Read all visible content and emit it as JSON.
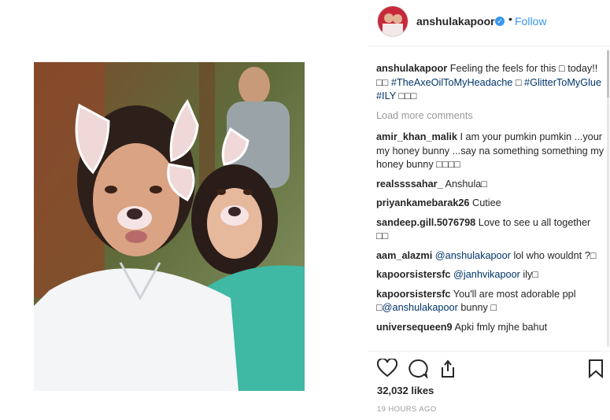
{
  "post": {
    "username": "anshulakapoor",
    "follow_label": "Follow",
    "separator": "•",
    "verified_glyph": "✓",
    "caption": {
      "user": "anshulakapoor",
      "text": "Feeling the feels for this □ today!! □□ ",
      "tag1": "#TheAxeOilToMyHeadache",
      "mid": " □ ",
      "tag2": "#GlitterToMyGlue",
      "tag3": "#ILY",
      "end": " □□□"
    },
    "load_more": "Load more comments",
    "comments": [
      {
        "user": "amir_khan_malik",
        "text": "I am your pumkin pumkin ...your my honey bunny ...say na something something my honey bunny □□□□"
      },
      {
        "user": "realssssahar_",
        "text": "Anshula□"
      },
      {
        "user": "priyankamebarak26",
        "text": "Cutiee"
      },
      {
        "user": "sandeep.gill.5076798",
        "text": "Love to see u all together □□"
      },
      {
        "user": "aam_alazmi",
        "mention": "@anshulakapoor",
        "text": "lol who wouldnt ?□"
      },
      {
        "user": "kapoorsistersfc",
        "mention": "@janhvikapoor",
        "text": "ily□"
      },
      {
        "user": "kapoorsistersfc",
        "pre": "You'll are most adorable ppl □",
        "mention": "@anshulakapoor",
        "text": "bunny □"
      },
      {
        "user": "universequeen9",
        "text": "Apki fmly mjhe bahut"
      }
    ],
    "likes": "32,032 likes",
    "timestamp": "19 HOURS AGO",
    "icons": {
      "like": "heart-icon",
      "comment": "comment-icon",
      "share": "share-icon",
      "save": "bookmark-icon",
      "verified": "verified-badge-icon"
    },
    "colors": {
      "link": "#3897f0",
      "hashtag": "#003569",
      "muted": "#999999",
      "text": "#262626"
    }
  }
}
